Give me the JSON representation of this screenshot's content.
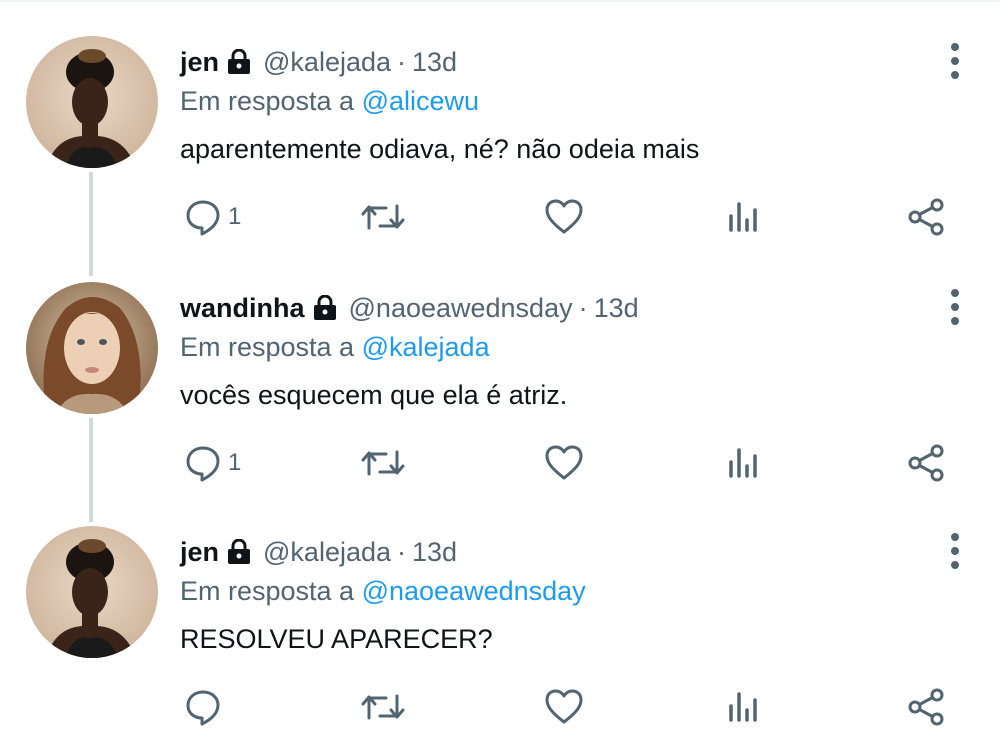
{
  "tweets": [
    {
      "name": "jen",
      "handle": "@kalejada",
      "separator": "·",
      "time": "13d",
      "reply_prefix": "Em resposta a",
      "reply_to": "@alicewu",
      "text": "aparentemente odiava, né? não odeia mais",
      "reply_count": "1",
      "avatar": "jen-avatar"
    },
    {
      "name": "wandinha",
      "handle": "@naoeawednsday",
      "separator": "·",
      "time": "13d",
      "reply_prefix": "Em resposta a",
      "reply_to": "@kalejada",
      "text": "vocês esquecem que ela é atriz.",
      "reply_count": "1",
      "avatar": "wandinha-avatar"
    },
    {
      "name": "jen",
      "handle": "@kalejada",
      "separator": "·",
      "time": "13d",
      "reply_prefix": "Em resposta a",
      "reply_to": "@naoeawednsday",
      "text": "RESOLVEU APARECER?",
      "reply_count": "",
      "avatar": "jen-avatar"
    }
  ],
  "icons": [
    "lock-icon",
    "more-icon",
    "reply-icon",
    "retweet-icon",
    "like-icon",
    "stats-icon",
    "share-icon"
  ],
  "colors": {
    "text": "#0f1419",
    "muted": "#536471",
    "link": "#1d9bf0",
    "thread_line": "#cfd9de"
  }
}
